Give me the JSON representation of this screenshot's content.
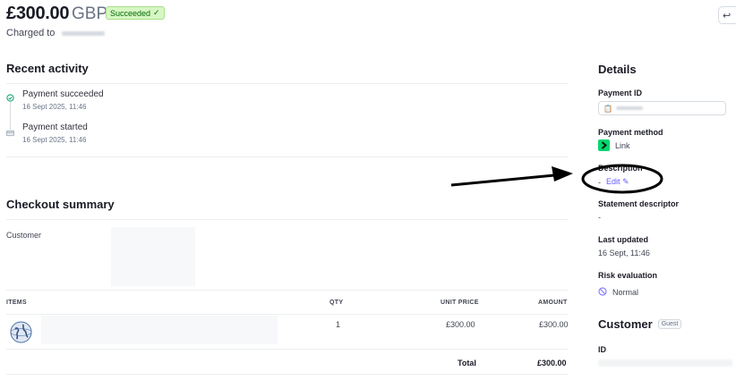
{
  "header": {
    "amount": "£300.00",
    "currency": "GBP",
    "status": "Succeeded",
    "charged_to_label": "Charged to"
  },
  "activity": {
    "title": "Recent activity",
    "events": [
      {
        "title": "Payment succeeded",
        "time": "16 Sept 2025, 11:46"
      },
      {
        "title": "Payment started",
        "time": "16 Sept 2025, 11:46"
      }
    ]
  },
  "checkout": {
    "title": "Checkout summary",
    "customer_label": "Customer",
    "columns": {
      "items": "ITEMS",
      "qty": "QTY",
      "unit_price": "UNIT PRICE",
      "amount": "AMOUNT"
    },
    "rows": [
      {
        "qty": "1",
        "unit_price": "£300.00",
        "amount": "£300.00"
      }
    ],
    "total_label": "Total",
    "total_value": "£300.00"
  },
  "details": {
    "title": "Details",
    "payment_id_label": "Payment ID",
    "payment_method_label": "Payment method",
    "payment_method_value": "Link",
    "description_label": "Description",
    "description_value": "-",
    "edit_label": "Edit",
    "statement_label": "Statement descriptor",
    "statement_value": "-",
    "last_updated_label": "Last updated",
    "last_updated_value": "16 Sept, 11:46",
    "risk_label": "Risk evaluation",
    "risk_value": "Normal"
  },
  "customer": {
    "title": "Customer",
    "badge": "Guest",
    "id_label": "ID"
  },
  "colors": {
    "success": "#05690d",
    "accent": "#635bff",
    "link_green": "#00d66f"
  }
}
